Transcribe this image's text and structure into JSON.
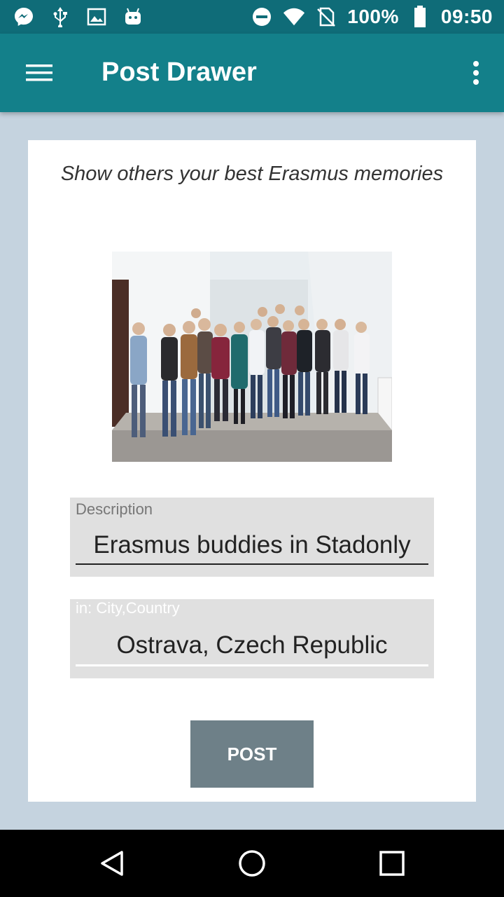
{
  "status_bar": {
    "battery_percent": "100%",
    "time": "09:50",
    "left_icons": [
      "messenger-icon",
      "usb-icon",
      "gallery-icon",
      "android-icon"
    ],
    "right_icons": [
      "do-not-disturb-icon",
      "wifi-icon",
      "no-sim-icon",
      "battery-icon"
    ]
  },
  "app_bar": {
    "title": "Post Drawer",
    "menu_icon": "hamburger-menu-icon",
    "overflow_icon": "more-vert-icon",
    "color": "#13808a"
  },
  "card": {
    "headline": "Show others your best Erasmus memories",
    "photo_icon": "group-photo"
  },
  "form": {
    "description": {
      "label": "Description",
      "value": "Erasmus buddies in Stadonly"
    },
    "location": {
      "label": "in: City,Country",
      "value": "Ostrava, Czech Republic"
    },
    "post_label": "POST"
  },
  "nav_bar": {
    "buttons": [
      "back-icon",
      "home-icon",
      "recents-icon"
    ]
  },
  "colors": {
    "status_bar": "#0f6c78",
    "background": "#c5d3df",
    "post_button": "#6e8088"
  }
}
